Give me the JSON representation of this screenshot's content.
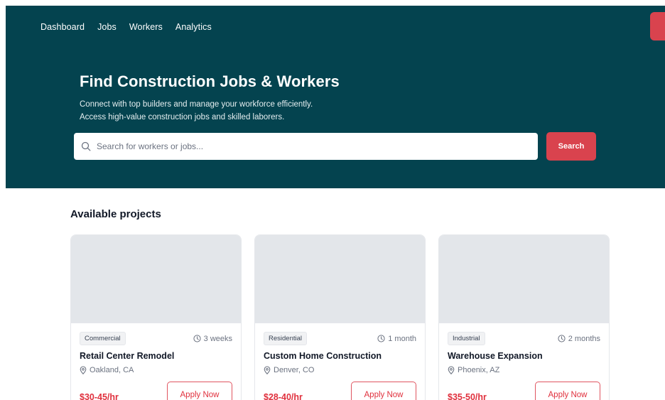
{
  "nav": {
    "items": [
      "Dashboard",
      "Jobs",
      "Workers",
      "Analytics"
    ]
  },
  "hero": {
    "title": "Find Construction Jobs & Workers",
    "subtitle_line1": "Connect with top builders and manage your workforce efficiently.",
    "subtitle_line2": "Access high-value construction jobs and skilled laborers.",
    "search_placeholder": "Search for workers or jobs...",
    "search_button": "Search"
  },
  "section": {
    "title": "Available projects"
  },
  "projects": [
    {
      "category": "Commercial",
      "duration": "3 weeks",
      "title": "Retail Center Remodel",
      "location": "Oakland, CA",
      "rate": "$30-45/hr",
      "cta": "Apply Now"
    },
    {
      "category": "Residential",
      "duration": "1 month",
      "title": "Custom Home Construction",
      "location": "Denver, CO",
      "rate": "$28-40/hr",
      "cta": "Apply Now"
    },
    {
      "category": "Industrial",
      "duration": "2 months",
      "title": "Warehouse Expansion",
      "location": "Phoenix, AZ",
      "rate": "$35-50/hr",
      "cta": "Apply Now"
    }
  ],
  "colors": {
    "hero_bg": "#04434f",
    "accent": "#d9434e",
    "rate_text": "#e0303d"
  },
  "icons": {
    "search": "search-icon",
    "duration": "clock-icon",
    "location": "map-pin-icon"
  }
}
